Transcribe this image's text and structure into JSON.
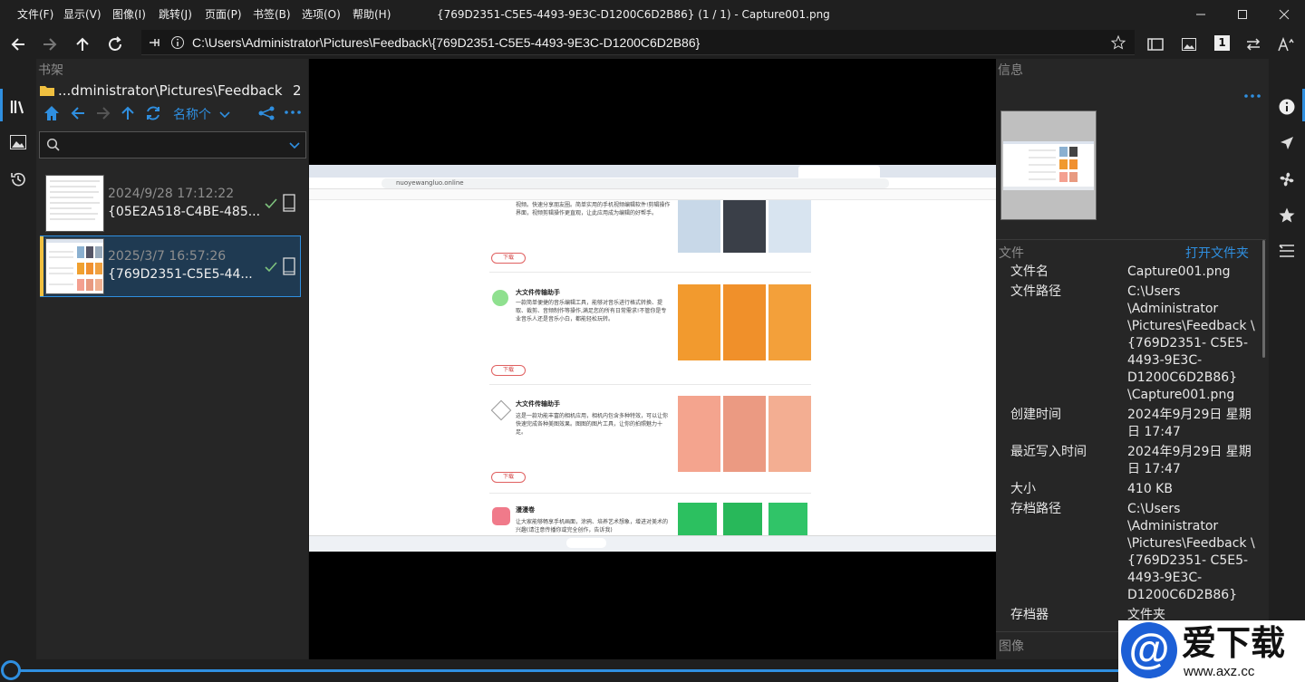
{
  "menu": [
    "文件(F)",
    "显示(V)",
    "图像(I)",
    "跳转(J)",
    "页面(P)",
    "书签(B)",
    "选项(O)",
    "帮助(H)"
  ],
  "window_title": "{769D2351-C5E5-4493-9E3C-D1200C6D2B86} (1 / 1) - Capture001.png",
  "address": "C:\\Users\\Administrator\\Pictures\\Feedback\\{769D2351-C5E5-4493-9E3C-D1200C6D2B86}",
  "page_counter": "1",
  "shelf": {
    "title": "书架",
    "folder": "...dministrator\\Pictures\\Feedback",
    "count": "2",
    "sort_label": "名称个",
    "search_placeholder": "",
    "items": [
      {
        "date": "2024/9/28 17:12:22",
        "name": "{05E2A518-C4BE-485..."
      },
      {
        "date": "2025/3/7 16:57:26",
        "name": "{769D2351-C5E5-44..."
      }
    ]
  },
  "info": {
    "title": "信息",
    "file_section": "文件",
    "open_folder": "打开文件夹",
    "image_section": "图像",
    "fields": [
      {
        "key": "文件名",
        "value": "Capture001.png"
      },
      {
        "key": "文件路径",
        "value": "C:\\Users \\Administrator \\Pictures\\Feedback \\{769D2351- C5E5-4493-9E3C- D1200C6D2B86} \\Capture001.png"
      },
      {
        "key": "创建时间",
        "value": "2024年9月29日 星期日 17:47"
      },
      {
        "key": "最近写入时间",
        "value": "2024年9月29日 星期日 17:47"
      },
      {
        "key": "大小",
        "value": "410 KB"
      },
      {
        "key": "存档路径",
        "value": "C:\\Users \\Administrator \\Pictures\\Feedback \\{769D2351- C5E5-4493-9E3C- D1200C6D2B86}"
      },
      {
        "key": "存档器",
        "value": "文件夹"
      }
    ]
  },
  "screenshot": {
    "url": "nuoyewangluo.online",
    "sections": [
      {
        "title": "",
        "text": "视频。快速分享朋友圈。简单实用的手机视频编辑软件!剪辑操作界面，视频剪辑操作更直观，让此应用成为编辑的好帮手。",
        "btn": "下载"
      },
      {
        "title": "大文件传输助手",
        "text": "一款简单便捷的音乐编辑工具，能够对音乐进行格式转换、提取、裁剪、音频制作等操作,满足您的所有日常需求!不管你是专业音乐人还是音乐小白，都能轻松玩转。",
        "btn": "下载"
      },
      {
        "title": "大文件传输助手",
        "text": "这是一款功能丰富的相机应用，相机内包含多种特效，可以让你快速完成各种美图效果。图图的图片工具，让你的拍照魅力十足。",
        "btn": "下载"
      },
      {
        "title": "漫漫卷",
        "text": "让大家能够畅享手机画面，涂鸦、培养艺术想象，增进对美术的兴趣(请注意传播你或完全创作，告诉我)",
        "btn": ""
      }
    ]
  },
  "watermark": {
    "brand": "爱下载",
    "url": "www.axz.cc"
  },
  "colors": {
    "accent": "#2f8fe0",
    "check": "#7ec27e",
    "folder": "#f0c040"
  }
}
